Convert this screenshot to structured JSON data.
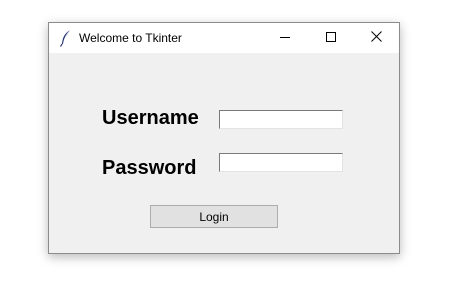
{
  "window": {
    "title": "Welcome to Tkinter",
    "app_icon": "feather-icon",
    "controls": {
      "minimize_icon": "minimize-icon",
      "maximize_icon": "maximize-icon",
      "close_icon": "close-icon"
    }
  },
  "form": {
    "username_label": "Username",
    "username_value": "",
    "password_label": "Password",
    "password_value": "",
    "login_label": "Login"
  },
  "colors": {
    "window_background": "#f0f0f0",
    "titlebar_background": "#ffffff",
    "button_background": "#e1e1e1",
    "button_border": "#adadad"
  }
}
